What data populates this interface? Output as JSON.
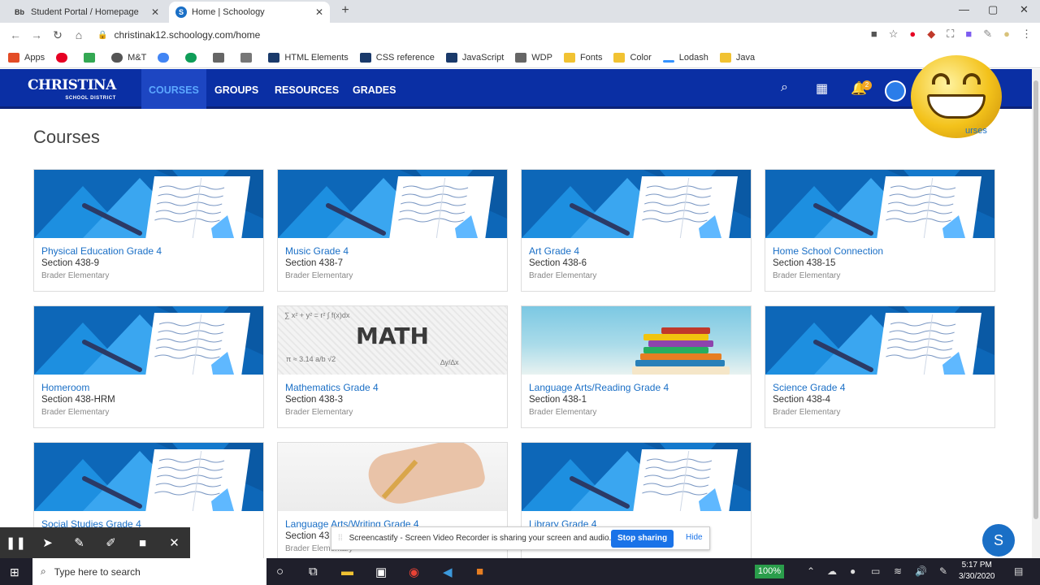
{
  "browser": {
    "tabs": [
      {
        "label": "Student Portal / Homepage",
        "favicon": "Bb",
        "active": false
      },
      {
        "label": "Home | Schoology",
        "favicon": "S",
        "active": true
      }
    ],
    "url": "christinak12.schoology.com/home",
    "bookmarks": [
      {
        "label": "Apps",
        "color": "#e34c26"
      },
      {
        "label": "",
        "color": "#e60023"
      },
      {
        "label": "",
        "color": "#34a853"
      },
      {
        "label": "M&T",
        "color": "#555555"
      },
      {
        "label": "",
        "color": "#4285f4"
      },
      {
        "label": "",
        "color": "#0f9d58"
      },
      {
        "label": "",
        "color": "#666666"
      },
      {
        "label": "",
        "color": "#777777"
      },
      {
        "label": "HTML Elements",
        "color": "#1a3a6b"
      },
      {
        "label": "CSS reference",
        "color": "#1a3a6b"
      },
      {
        "label": "JavaScript",
        "color": "#1a3a6b"
      },
      {
        "label": "WDP",
        "color": "#666666"
      },
      {
        "label": "Fonts",
        "color": "#f1c232"
      },
      {
        "label": "Color",
        "color": "#f1c232"
      },
      {
        "label": "Lodash",
        "color": "#3492ff"
      },
      {
        "label": "Java",
        "color": "#f1c232"
      }
    ]
  },
  "header": {
    "logo_main": "CHRISTINA",
    "logo_sub": "SCHOOL DISTRICT",
    "nav": [
      "COURSES",
      "GROUPS",
      "RESOURCES",
      "GRADES"
    ],
    "active_nav": "COURSES",
    "notification_count": "2",
    "brand_color": "#0a2fa4"
  },
  "main": {
    "title": "Courses",
    "all_courses_link": "urses",
    "courses": [
      {
        "name": "Physical Education Grade 4",
        "section": "Section 438-9",
        "school": "Brader Elementary",
        "art": "default"
      },
      {
        "name": "Music Grade 4",
        "section": "Section 438-7",
        "school": "Brader Elementary",
        "art": "default"
      },
      {
        "name": "Art Grade 4",
        "section": "Section 438-6",
        "school": "Brader Elementary",
        "art": "default"
      },
      {
        "name": "Home School Connection",
        "section": "Section 438-15",
        "school": "Brader Elementary",
        "art": "default"
      },
      {
        "name": "Homeroom",
        "section": "Section 438-HRM",
        "school": "Brader Elementary",
        "art": "default"
      },
      {
        "name": "Mathematics Grade 4",
        "section": "Section 438-3",
        "school": "Brader Elementary",
        "art": "math"
      },
      {
        "name": "Language Arts/Reading Grade 4",
        "section": "Section 438-1",
        "school": "Brader Elementary",
        "art": "books"
      },
      {
        "name": "Science Grade 4",
        "section": "Section 438-4",
        "school": "Brader Elementary",
        "art": "default"
      },
      {
        "name": "Social Studies Grade 4",
        "section": "",
        "school": "",
        "art": "default"
      },
      {
        "name": "Language Arts/Writing Grade 4",
        "section": "Section 43",
        "school": "Brader Elementary",
        "art": "writing"
      },
      {
        "name": "Library Grade 4",
        "section": "",
        "school": "",
        "art": "default"
      }
    ],
    "math_word": "MATH"
  },
  "screencastify": {
    "message": "Screencastify - Screen Video Recorder is sharing your screen and audio.",
    "stop_label": "Stop sharing",
    "hide_label": "Hide"
  },
  "help_fab": "S",
  "taskbar": {
    "search_placeholder": "Type here to search",
    "battery": "100%",
    "time": "5:17 PM",
    "date": "3/30/2020"
  }
}
